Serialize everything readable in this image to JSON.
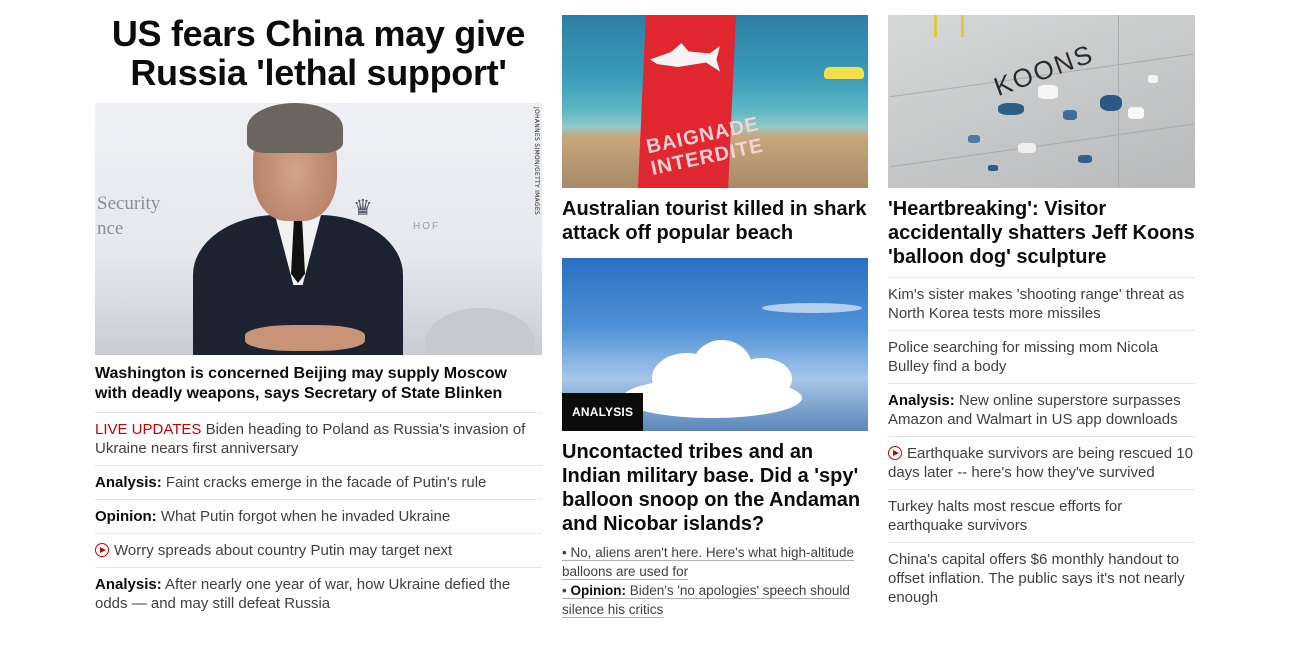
{
  "left": {
    "headline": "US fears China may give Russia 'lethal support'",
    "hero_credit": "JOHANNES SIMON/GETTY IMAGES",
    "hero_wall_text": [
      "Security",
      "nce"
    ],
    "hero_emblem_text": "HOF",
    "subheadline": "Washington is concerned Beijing may supply Moscow with deadly weapons, says Secretary of State Blinken",
    "items": [
      {
        "prefix": "LIVE UPDATES",
        "text": " Biden heading to Poland as Russia's invasion of Ukraine nears first anniversary"
      },
      {
        "prefix": "Analysis:",
        "text": " Faint cracks emerge in the facade of Putin's rule"
      },
      {
        "prefix": "Opinion:",
        "text": " What Putin forgot when he invaded Ukraine"
      },
      {
        "prefix": "",
        "text": "Worry spreads about country Putin may target next",
        "icon": "play-icon"
      },
      {
        "prefix": "Analysis:",
        "text": " After nearly one year of war, how Ukraine defied the odds — and may still defeat Russia"
      }
    ]
  },
  "middle": {
    "beach_flag_text": "BAIGNADE INTERDITE",
    "story1_headline": "Australian tourist killed in shark attack off popular beach",
    "badge": "ANALYSIS",
    "story2_headline": "Uncontacted tribes and an Indian military base. Did a 'spy' balloon snoop on the Andaman and Nicobar islands?",
    "bullets": [
      {
        "prefix": "",
        "text": "No, aliens aren't here. Here's what high-altitude balloons are used for"
      },
      {
        "prefix": "Opinion:",
        "text": " Biden's 'no apologies' speech should silence his critics"
      }
    ]
  },
  "right": {
    "koons_label": "KOONS",
    "headline": "'Heartbreaking': Visitor accidentally shatters Jeff Koons 'balloon dog' sculpture",
    "items": [
      {
        "prefix": "",
        "text": "Kim's sister makes 'shooting range' threat as North Korea tests more missiles"
      },
      {
        "prefix": "",
        "text": "Police searching for missing mom Nicola Bulley find a body"
      },
      {
        "prefix": "Analysis:",
        "text": " New online superstore surpasses Amazon and Walmart in US app downloads"
      },
      {
        "prefix": "",
        "text": "Earthquake survivors are being rescued 10 days later -- here's how they've survived",
        "icon": "play-icon"
      },
      {
        "prefix": "",
        "text": "Turkey halts most rescue efforts for earthquake survivors"
      },
      {
        "prefix": "",
        "text": "China's capital offers $6 monthly handout to offset inflation. The public says it's not nearly enough"
      }
    ]
  },
  "colors": {
    "live_red": "#cc0000",
    "text_dark": "#0c0c0c",
    "text_body": "#404040",
    "divider": "#e6e6e6",
    "badge_bg": "#0c0c0c"
  }
}
